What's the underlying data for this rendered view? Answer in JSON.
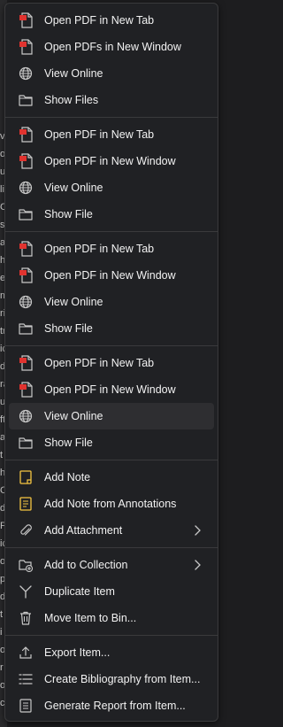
{
  "background_chars": [
    "v",
    "oi",
    "u",
    "li",
    "C",
    "st",
    "aj",
    "h",
    "e",
    "m",
    "ri",
    "tr",
    "ic",
    "d",
    "ra",
    "u",
    "ft",
    "a",
    "t",
    "h",
    "C",
    "d",
    "F",
    "ic",
    "o",
    "p",
    "d",
    "t",
    "i",
    "o",
    "r",
    "o",
    "c"
  ],
  "groups": [
    {
      "items": [
        {
          "icon": "pdf-icon",
          "label": "Open PDF in New Tab"
        },
        {
          "icon": "pdf-icon",
          "label": "Open PDFs in New Window"
        },
        {
          "icon": "globe-icon",
          "label": "View Online"
        },
        {
          "icon": "folder-icon",
          "label": "Show Files"
        }
      ]
    },
    {
      "items": [
        {
          "icon": "pdf-icon",
          "label": "Open PDF in New Tab"
        },
        {
          "icon": "pdf-icon",
          "label": "Open PDF in New Window"
        },
        {
          "icon": "globe-icon",
          "label": "View Online"
        },
        {
          "icon": "folder-icon",
          "label": "Show File"
        }
      ]
    },
    {
      "items": [
        {
          "icon": "pdf-icon",
          "label": "Open PDF in New Tab"
        },
        {
          "icon": "pdf-icon",
          "label": "Open PDF in New Window"
        },
        {
          "icon": "globe-icon",
          "label": "View Online"
        },
        {
          "icon": "folder-icon",
          "label": "Show File"
        }
      ]
    },
    {
      "items": [
        {
          "icon": "pdf-icon",
          "label": "Open PDF in New Tab"
        },
        {
          "icon": "pdf-icon",
          "label": "Open PDF in New Window"
        },
        {
          "icon": "globe-icon",
          "label": "View Online",
          "highlighted": true
        },
        {
          "icon": "folder-icon",
          "label": "Show File"
        }
      ]
    },
    {
      "items": [
        {
          "icon": "note-icon",
          "label": "Add Note"
        },
        {
          "icon": "note-annotations-icon",
          "label": "Add Note from Annotations"
        },
        {
          "icon": "paperclip-icon",
          "label": "Add Attachment",
          "submenu": true
        }
      ]
    },
    {
      "items": [
        {
          "icon": "add-to-collection-icon",
          "label": "Add to Collection",
          "submenu": true
        },
        {
          "icon": "duplicate-icon",
          "label": "Duplicate Item"
        },
        {
          "icon": "trash-icon",
          "label": "Move Item to Bin..."
        }
      ]
    },
    {
      "items": [
        {
          "icon": "export-icon",
          "label": "Export Item..."
        },
        {
          "icon": "bibliography-icon",
          "label": "Create Bibliography from Item..."
        },
        {
          "icon": "report-icon",
          "label": "Generate Report from Item..."
        }
      ]
    }
  ],
  "colors": {
    "menu_bg": "#202124",
    "text": "#f2f2f2",
    "pdf_red": "#e0332f",
    "note_yellow": "#f5c542",
    "icon_gray": "#c8c8c8"
  }
}
